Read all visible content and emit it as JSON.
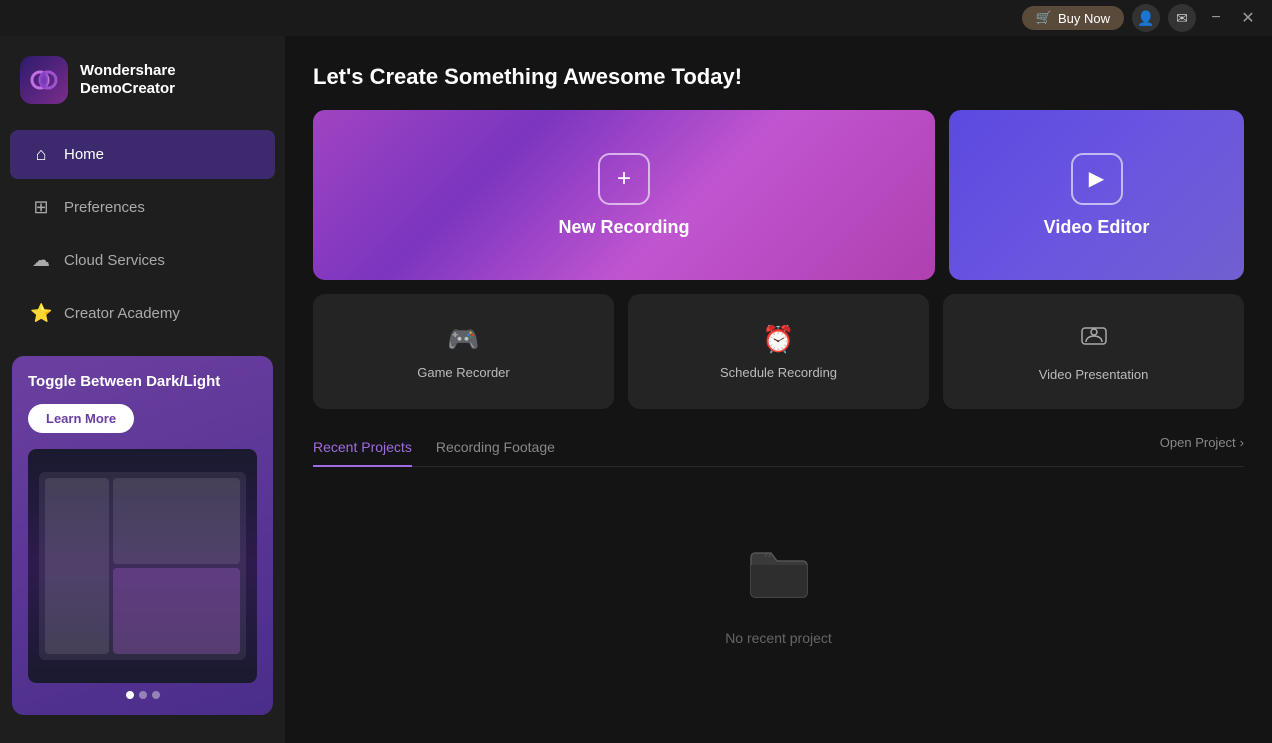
{
  "titlebar": {
    "buy_now_label": "Buy Now",
    "minimize_label": "−",
    "close_label": "✕"
  },
  "sidebar": {
    "logo": {
      "title_line1": "Wondershare",
      "title_line2": "DemoCreator"
    },
    "nav": [
      {
        "id": "home",
        "label": "Home",
        "icon": "⌂",
        "active": true
      },
      {
        "id": "preferences",
        "label": "Preferences",
        "icon": "⊞"
      },
      {
        "id": "cloud-services",
        "label": "Cloud Services",
        "icon": "☁"
      },
      {
        "id": "creator-academy",
        "label": "Creator Academy",
        "icon": "⭐"
      }
    ],
    "promo": {
      "title": "Toggle Between Dark/Light",
      "learn_more_label": "Learn More",
      "dots": [
        false,
        false,
        false
      ]
    }
  },
  "main": {
    "heading": "Let's Create Something Awesome Today!",
    "cards": {
      "new_recording": {
        "label": "New Recording",
        "icon": "+"
      },
      "video_editor": {
        "label": "Video Editor",
        "icon": "▶"
      },
      "small_cards": [
        {
          "id": "game-recorder",
          "label": "Game Recorder",
          "icon": "🎮"
        },
        {
          "id": "schedule-recording",
          "label": "Schedule Recording",
          "icon": "⏰"
        },
        {
          "id": "video-presentation",
          "label": "Video Presentation",
          "icon": "👤"
        }
      ]
    },
    "tabs": [
      {
        "id": "recent-projects",
        "label": "Recent Projects",
        "active": true
      },
      {
        "id": "recording-footage",
        "label": "Recording Footage",
        "active": false
      }
    ],
    "open_project_label": "Open Project",
    "empty_state": {
      "label": "No recent project"
    }
  }
}
